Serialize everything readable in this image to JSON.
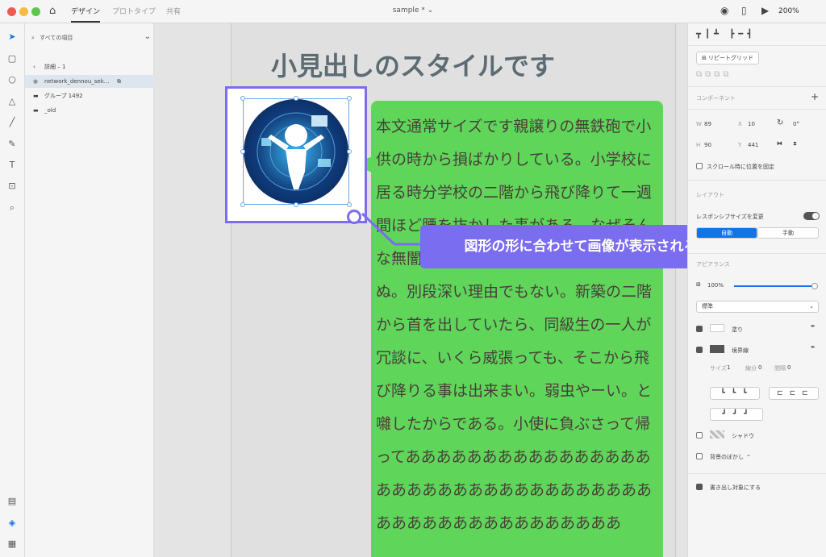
{
  "titlebar": {
    "tabs": [
      "デザイン",
      "プロトタイプ",
      "共有"
    ],
    "doc_title": "sample *",
    "zoom": "200%"
  },
  "layers": {
    "search_placeholder": "すべての項目",
    "breadcrumb": "詳細 – 1",
    "items": [
      "network_dennou_sek...",
      "グループ 1492",
      "_old"
    ]
  },
  "canvas": {
    "heading": "小見出しのスタイルです",
    "body": "本文通常サイズです親譲りの無鉄砲で小供の時から損ばかりしている。小学校に居る時分学校の二階から飛び降りて一週間ほど腰を抜かした事がある。なぜそんな無闇をしたと聞く人があるかも知れぬ。別段深い理由でもない。新築の二階から首を出していたら、同級生の一人が冗談に、いくら威張っても、そこから飛び降りる事は出来まい。弱虫やーい。と囃したからである。小使に負ぶさって帰ってああああああああああああああああああああああああああああああああああああああああああああああああああ",
    "callout": "図形の形に合わせて画像が表示される"
  },
  "right_panel": {
    "repeat_grid": "リピートグリッド",
    "component_label": "コンポーネント",
    "w_label": "W",
    "w": "89",
    "x_label": "X",
    "x": "10",
    "rotation": "0°",
    "h_label": "H",
    "h": "90",
    "y_label": "Y",
    "y": "441",
    "fix_scroll": "スクロール時に位置を固定",
    "layout_label": "レイアウト",
    "responsive": "レスポンシブサイズを変更",
    "auto": "自動",
    "manual": "手動",
    "appearance_label": "アピアランス",
    "opacity": "100%",
    "blend": "標準",
    "fill": "塗り",
    "border": "境界線",
    "size_label": "サイズ",
    "size": "1",
    "dash_label": "線分",
    "dash": "0",
    "gap_label": "間隔",
    "gap": "0",
    "shadow": "シャドウ",
    "bg_blur": "背景のぼかし",
    "export": "書き出し対象にする"
  },
  "colors": {
    "accent": "#7b6df0",
    "green": "#5fd65a",
    "heading": "#5d6b73"
  }
}
